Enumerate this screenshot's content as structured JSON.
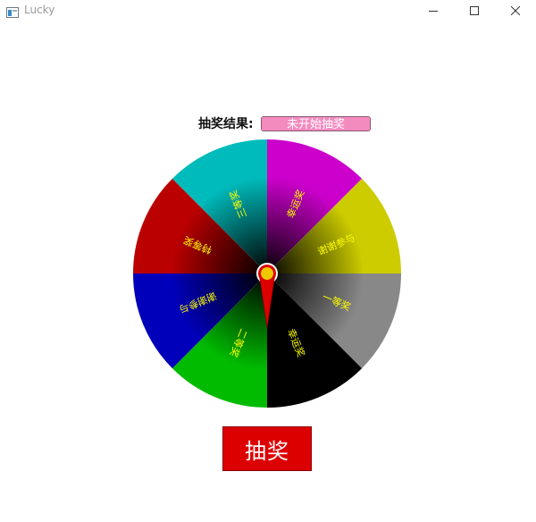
{
  "window": {
    "title": "Lucky"
  },
  "result": {
    "label": "抽奖结果:",
    "value": "未开始抽奖"
  },
  "wheel": {
    "segments": [
      {
        "label": "幸运奖",
        "color": "#cc00cc"
      },
      {
        "label": "谢谢参与",
        "color": "#cccc00"
      },
      {
        "label": "一等奖",
        "color": "#888888"
      },
      {
        "label": "幸运奖",
        "color": "#000000"
      },
      {
        "label": "二等奖",
        "color": "#00bb00"
      },
      {
        "label": "谢谢参与",
        "color": "#0000bb"
      },
      {
        "label": "特等奖",
        "color": "#bb0000"
      },
      {
        "label": "三等奖",
        "color": "#00bbbb"
      }
    ],
    "label_color": "#ffff00",
    "pointer_color": "#dd0000",
    "hub_color": "#f0c800"
  },
  "draw_button": {
    "label": "抽奖"
  }
}
